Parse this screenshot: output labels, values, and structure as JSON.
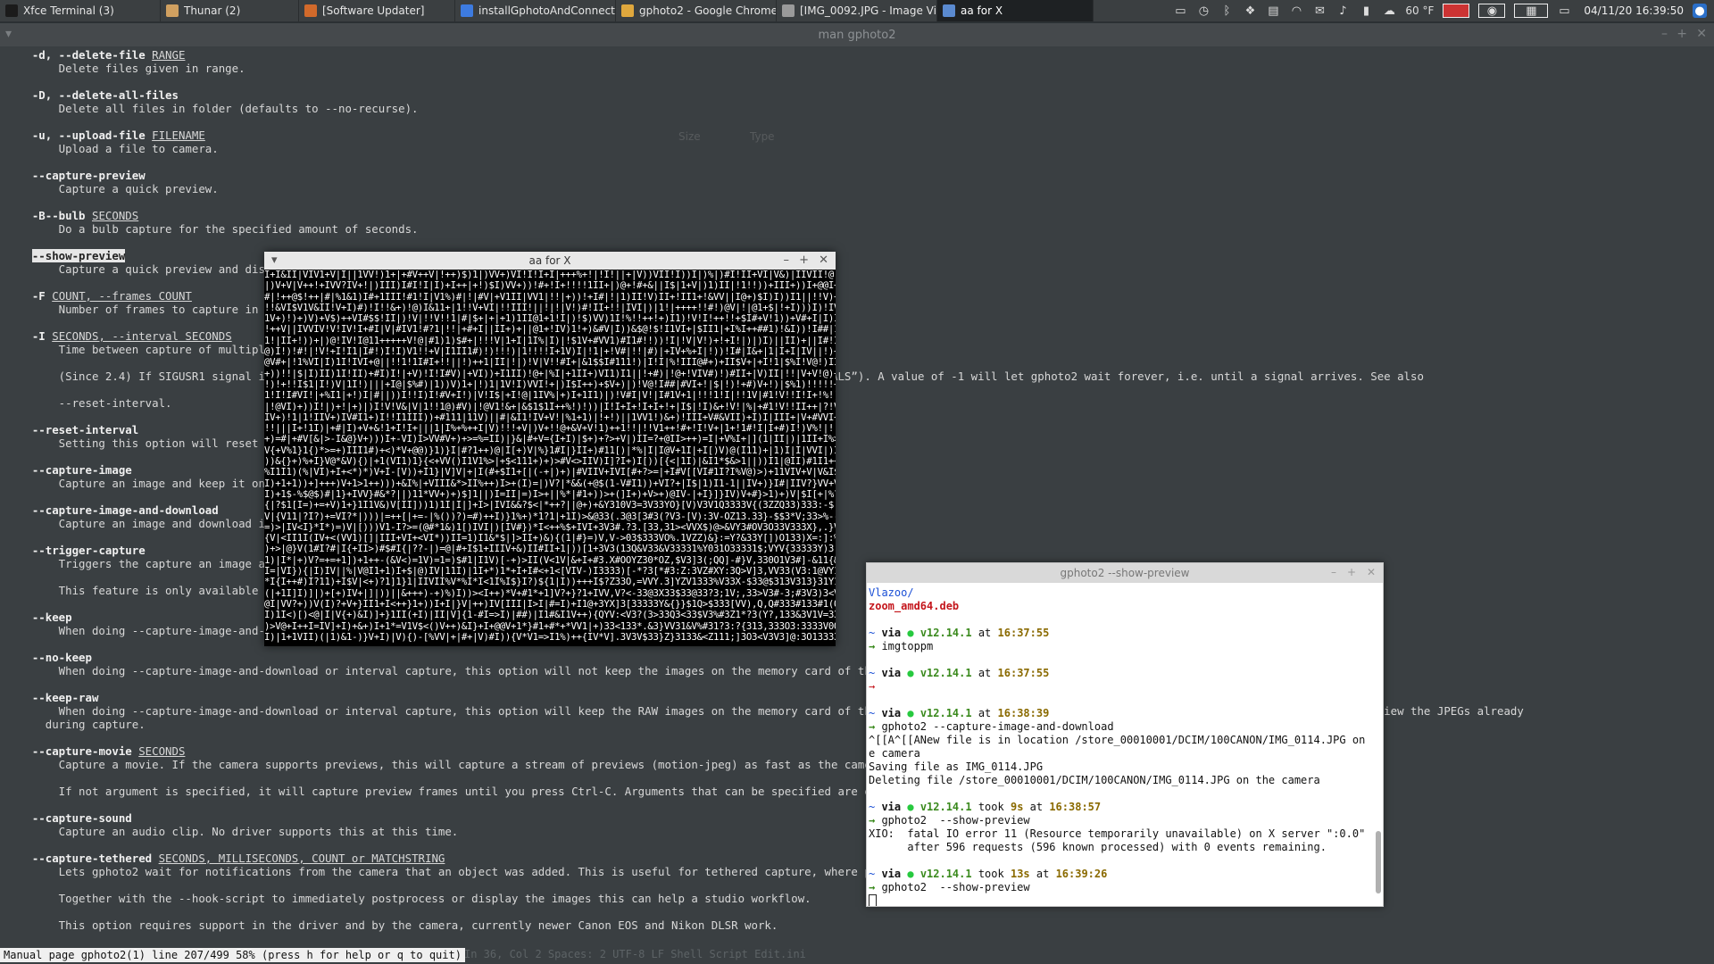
{
  "taskbar": {
    "tasks": [
      {
        "label": "Xfce Terminal (3)",
        "icon": "terminal-icon",
        "color": "#1b1b1b"
      },
      {
        "label": "Thunar (2)",
        "icon": "home-folder-icon",
        "color": "#d0a060"
      },
      {
        "label": "[Software Updater]",
        "icon": "updater-icon",
        "color": "#d26a2b"
      },
      {
        "label": "installGphotoAndConnect...",
        "icon": "chrome-icon",
        "color": "#3d7be0"
      },
      {
        "label": "gphoto2 - Google Chrome",
        "icon": "chrome-icon",
        "color": "#e0a83d"
      },
      {
        "label": "[IMG_0092.JPG - Image Vi...",
        "icon": "image-viewer-icon",
        "color": "#9a9a9a"
      },
      {
        "label": "aa for X",
        "icon": "window-icon",
        "color": "#5a8ad0"
      }
    ],
    "tray": {
      "weather": "60 °F",
      "clock": "04/11/20 16:39:50"
    }
  },
  "man_window": {
    "title": "man gphoto2",
    "status_line": "Manual page gphoto2(1) line 207/499 58% (press h for help or q to quit)",
    "editor_status": "In 36, Col 2     Spaces: 2     UTF-8     LF     Shell Script     Edit.ini",
    "lines": [
      {
        "opt": "-d, --delete-file",
        "arg": "RANGE",
        "desc": "Delete files given in range."
      },
      {
        "opt": "-D, --delete-all-files",
        "arg": "",
        "desc": "Delete all files in folder (defaults to --no-recurse)."
      },
      {
        "opt": "-u, --upload-file",
        "arg": "FILENAME",
        "desc": "Upload a file to camera."
      },
      {
        "opt": "--capture-preview",
        "arg": "",
        "desc": "Capture a quick preview."
      },
      {
        "opt": "-B--bulb",
        "arg": "SECONDS",
        "desc": "Do a bulb capture for the specified amount of seconds."
      },
      {
        "opt": "--show-preview",
        "arg": "",
        "desc": "Capture a quick preview and dis"
      },
      {
        "opt": "-F",
        "arg": "COUNT, --frames COUNT",
        "desc": "Number of frames to capture in"
      },
      {
        "opt": "-I",
        "arg": "SECONDS, --interval SECONDS",
        "desc": "Time between capture of multipl"
      },
      {
        "opt": "",
        "arg": "",
        "desc": "(Since 2.4) If SIGUSR1 signal i                                               l period (see the section called “SIGNALS”). A value of -1 will let gphoto2 wait forever, i.e. until a signal arrives. See also"
      },
      {
        "opt": "",
        "arg": "",
        "desc": "--reset-interval."
      },
      {
        "opt": "--reset-interval",
        "arg": "",
        "desc": "Setting this option will reset                                               ceived in time-lapse mode."
      },
      {
        "opt": "--capture-image",
        "arg": "",
        "desc": "Capture an image and keep it on"
      },
      {
        "opt": "--capture-image-and-download",
        "arg": "",
        "desc": "Capture an image and download i"
      },
      {
        "opt": "--trigger-capture",
        "arg": "",
        "desc": "Triggers the capture an image a"
      },
      {
        "opt": "",
        "arg": "",
        "desc": "This feature is only available"
      },
      {
        "opt": "--keep",
        "arg": "",
        "desc": "When doing --capture-image-and-                                               era."
      },
      {
        "opt": "--no-keep",
        "arg": "",
        "desc": "When doing --capture-image-and-download or interval capture, this option will not keep the images on the memory card of the came"
      },
      {
        "opt": "--keep-raw",
        "arg": "",
        "desc": "When doing --capture-image-and-download or interval capture, this option will keep the RAW images on the memory card of the came                                                    and you want to review the JPEGs already\n      during capture."
      },
      {
        "opt": "--capture-movie",
        "arg": "SECONDS",
        "desc": "Capture a movie. If the camera supports previews, this will capture a stream of previews (motion-jpeg) as fast as the camera ca"
      },
      {
        "opt": "",
        "arg": "",
        "desc": "If not argument is specified, it will capture preview frames until you press Ctrl-C. Arguments that can be specified are either"
      },
      {
        "opt": "--capture-sound",
        "arg": "",
        "desc": "Capture an audio clip. No driver supports this at this time."
      },
      {
        "opt": "--capture-tethered",
        "arg": "SECONDS, MILLISECONDS, COUNT or MATCHSTRING",
        "desc": "Lets gphoto2 wait for notifications from the camera that an object was added. This is useful for tethered capture, where pressi                                              ssing."
      },
      {
        "opt": "",
        "arg": "",
        "desc": "Together with the --hook-script to immediately postprocess or display the images this can help a studio workflow."
      },
      {
        "opt": "",
        "arg": "",
        "desc": "This option requires support in the driver and by the camera, currently newer Canon EOS and Nikon DLSR work."
      }
    ]
  },
  "aa_window": {
    "title": "aa for X"
  },
  "preview_terminal": {
    "title": "gphoto2 --show-preview",
    "lines": [
      {
        "type": "dir",
        "text": "Vlazoo/"
      },
      {
        "type": "deb",
        "text": "zoom_amd64.deb"
      },
      {
        "type": "blank",
        "text": ""
      },
      {
        "type": "prompt",
        "via": "via",
        "ver": "v12.14.1",
        "took": "",
        "time": "16:37:55"
      },
      {
        "type": "cmd",
        "text": "imgtoppm"
      },
      {
        "type": "blank",
        "text": ""
      },
      {
        "type": "prompt",
        "via": "via",
        "ver": "v12.14.1",
        "took": "",
        "time": "16:37:55"
      },
      {
        "type": "arrow",
        "text": ""
      },
      {
        "type": "blank",
        "text": ""
      },
      {
        "type": "prompt",
        "via": "via",
        "ver": "v12.14.1",
        "took": "",
        "time": "16:38:39"
      },
      {
        "type": "cmd",
        "text": "gphoto2 --capture-image-and-download"
      },
      {
        "type": "out",
        "text": "^[[A^[[ANew file is in location /store_00010001/DCIM/100CANON/IMG_0114.JPG on th"
      },
      {
        "type": "out",
        "text": "e camera"
      },
      {
        "type": "out",
        "text": "Saving file as IMG_0114.JPG"
      },
      {
        "type": "out",
        "text": "Deleting file /store_00010001/DCIM/100CANON/IMG_0114.JPG on the camera"
      },
      {
        "type": "blank",
        "text": ""
      },
      {
        "type": "prompt",
        "via": "via",
        "ver": "v12.14.1",
        "took": "9s",
        "time": "16:38:57"
      },
      {
        "type": "cmd",
        "text": "gphoto2  --show-preview"
      },
      {
        "type": "out",
        "text": "XIO:  fatal IO error 11 (Resource temporarily unavailable) on X server \":0.0\""
      },
      {
        "type": "out",
        "text": "      after 596 requests (596 known processed) with 0 events remaining."
      },
      {
        "type": "blank",
        "text": ""
      },
      {
        "type": "prompt",
        "via": "via",
        "ver": "v12.14.1",
        "took": "13s",
        "time": "16:39:26"
      },
      {
        "type": "cmd",
        "text": "gphoto2  --show-preview"
      }
    ]
  },
  "colors": {
    "panel": "#3b3f41",
    "man_bg": "#3a3f42",
    "terminal_bg": "#ffffff",
    "prompt_green": "#3b8a1e",
    "prompt_red": "#c4161c",
    "dir_blue": "#1a4fd6"
  }
}
